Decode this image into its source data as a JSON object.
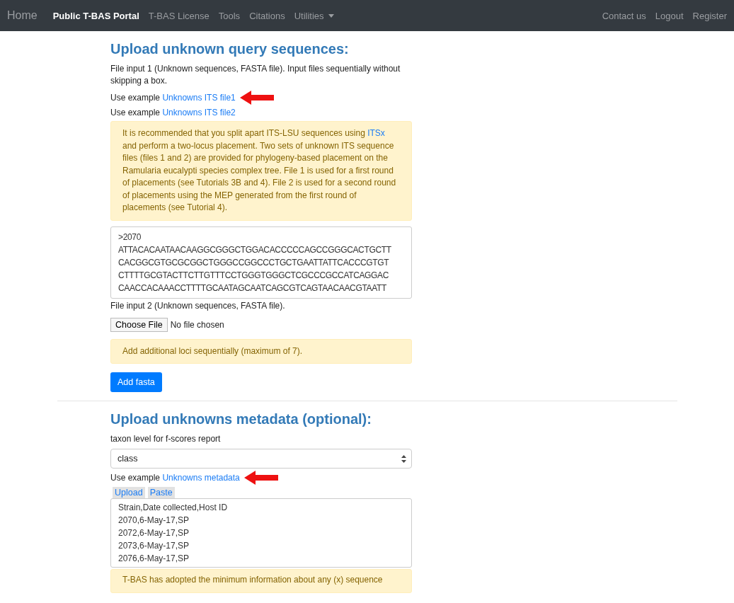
{
  "navbar": {
    "brand": "Home",
    "items": [
      {
        "label": "Public T-BAS Portal",
        "selected": true,
        "dropdown": false
      },
      {
        "label": "T-BAS License",
        "selected": false,
        "dropdown": false
      },
      {
        "label": "Tools",
        "selected": false,
        "dropdown": false
      },
      {
        "label": "Citations",
        "selected": false,
        "dropdown": false
      },
      {
        "label": "Utilities",
        "selected": false,
        "dropdown": true
      }
    ],
    "right_items": [
      "Contact us",
      "Logout",
      "Register"
    ]
  },
  "query_section": {
    "title": "Upload unknown query sequences:",
    "file_input_1_label": "File input 1 (Unknown sequences, FASTA file). Input files sequentially without skipping a box.",
    "examples": [
      {
        "prefix": "Use example",
        "link": "Unknowns ITS file1",
        "arrow": true
      },
      {
        "prefix": "Use example",
        "link": "Unknowns ITS file2",
        "arrow": false
      }
    ],
    "alert": {
      "before": "It is recommended that you split apart ITS-LSU sequences using",
      "link": "ITSx",
      "after": "and perform a two-locus placement. Two sets of unknown ITS sequence files (files 1 and 2) are provided for phylogeny-based placement on the Ramularia eucalypti species complex tree. File 1 is used for a first round of placements (see Tutorials 3B and 4). File 2 is used for a second round of placements using the MEP generated from the first round of placements (see Tutorial 4)."
    },
    "sequence_lines": [
      ">2070",
      "ATTACACAATAACAAGGCGGGCTGGACACCCCCAGCCGGGCACTGCTT",
      "CACGGCGTGCGCGGCTGGGCCGGCCCTGCTGAATTATTCACCCGTGT",
      "CTTTTGCGTACTTCTTGTTTCCTGGGTGGGCTCGCCCGCCATCAGGAC",
      "CAACCACAAACCTTTTGCAATAGCAATCAGCGTCAGTAACAACGTAATT"
    ],
    "file_input_2_label": "File input 2 (Unknown sequences, FASTA file).",
    "choose_file_button": "Choose File",
    "no_file_text": "No file chosen",
    "loci_alert": "Add additional loci sequentially (maximum of 7).",
    "add_button": "Add fasta"
  },
  "metadata_section": {
    "title": "Upload unknowns metadata (optional):",
    "taxon_label": "taxon level for f-scores report",
    "taxon_select": "class",
    "example": {
      "prefix": "Use example",
      "link": "Unknowns metadata",
      "arrow": true
    },
    "tabs": [
      "Upload",
      "Paste"
    ],
    "metadata_lines": [
      "Strain,Date collected,Host ID",
      "2070,6-May-17,SP",
      "2072,6-May-17,SP",
      "2073,6-May-17,SP",
      "2076,6-May-17,SP"
    ],
    "alert": "T-BAS has adopted the minimum information about any (x) sequence"
  }
}
